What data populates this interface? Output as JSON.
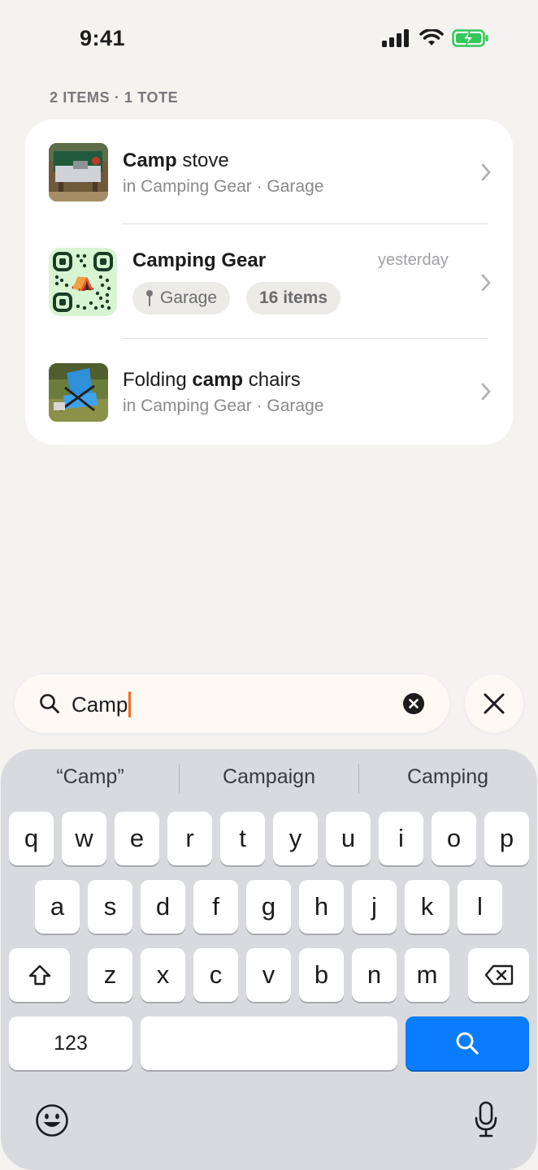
{
  "status_bar": {
    "time": "9:41"
  },
  "results": {
    "summary": "2 ITEMS · 1 TOTE",
    "rows": [
      {
        "title_bold": "Camp",
        "title_rest": " stove",
        "subtitle": "in Camping Gear · Garage"
      },
      {
        "title": "Camping Gear",
        "timestamp": "yesterday",
        "location_chip": "Garage",
        "count_chip": "16 items",
        "qr_emoji": "⛺"
      },
      {
        "title_pre": "Folding ",
        "title_bold": "camp",
        "title_rest": " chairs",
        "subtitle": "in Camping Gear · Garage"
      }
    ]
  },
  "search": {
    "value": "Camp"
  },
  "keyboard": {
    "suggestions": [
      "“Camp”",
      "Campaign",
      "Camping"
    ],
    "row1": [
      "q",
      "w",
      "e",
      "r",
      "t",
      "y",
      "u",
      "i",
      "o",
      "p"
    ],
    "row2": [
      "a",
      "s",
      "d",
      "f",
      "g",
      "h",
      "j",
      "k",
      "l"
    ],
    "row3": [
      "z",
      "x",
      "c",
      "v",
      "b",
      "n",
      "m"
    ],
    "numbers_label": "123"
  },
  "colors": {
    "accent_blue": "#0a7cff",
    "caret": "#f06a1f",
    "battery_green": "#34c759"
  },
  "icons": [
    "signal-icon",
    "wifi-icon",
    "battery-charging-icon",
    "chevron-right-icon",
    "location-pin-icon",
    "search-icon",
    "clear-icon",
    "close-icon",
    "shift-icon",
    "backspace-icon",
    "emoji-icon",
    "microphone-icon"
  ]
}
